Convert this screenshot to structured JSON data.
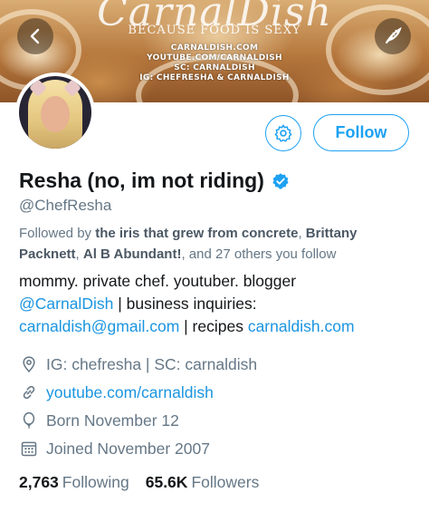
{
  "banner": {
    "brand_title": "CarnalDish",
    "tagline": "BECAUSE FOOD IS SEXY",
    "lines": [
      "CARNALDISH.COM",
      "YOUTUBE.COM/CARNALDISH",
      "SC: CARNALDISH",
      "IG: CHEFRESHA & CARNALDISH"
    ]
  },
  "actions": {
    "follow_label": "Follow"
  },
  "profile": {
    "display_name": "Resha (no, im not riding)",
    "handle": "@ChefResha",
    "followed_by": {
      "prefix": "Followed by ",
      "names": [
        "the iris that grew from concrete",
        "Brittany Packnett",
        "Al B Abundant!"
      ],
      "suffix": ", and 27 others you follow"
    },
    "bio": {
      "line1": "mommy. private chef. youtuber. blogger",
      "mention": "@CarnalDish",
      "mid": " | business inquiries:",
      "email": "carnaldish@gmail.com",
      "sep": " | recipes ",
      "site": "carnaldish.com"
    },
    "location": "IG: chefresha | SC: carnaldish",
    "website": "youtube.com/carnaldish",
    "born": "Born November 12",
    "joined": "Joined November 2007"
  },
  "stats": {
    "following_count": "2,763",
    "following_label": "Following",
    "followers_count": "65.6K",
    "followers_label": "Followers"
  },
  "colors": {
    "accent": "#1da1f2",
    "link": "#1b95e0",
    "muted": "#657786",
    "text": "#14171a"
  }
}
